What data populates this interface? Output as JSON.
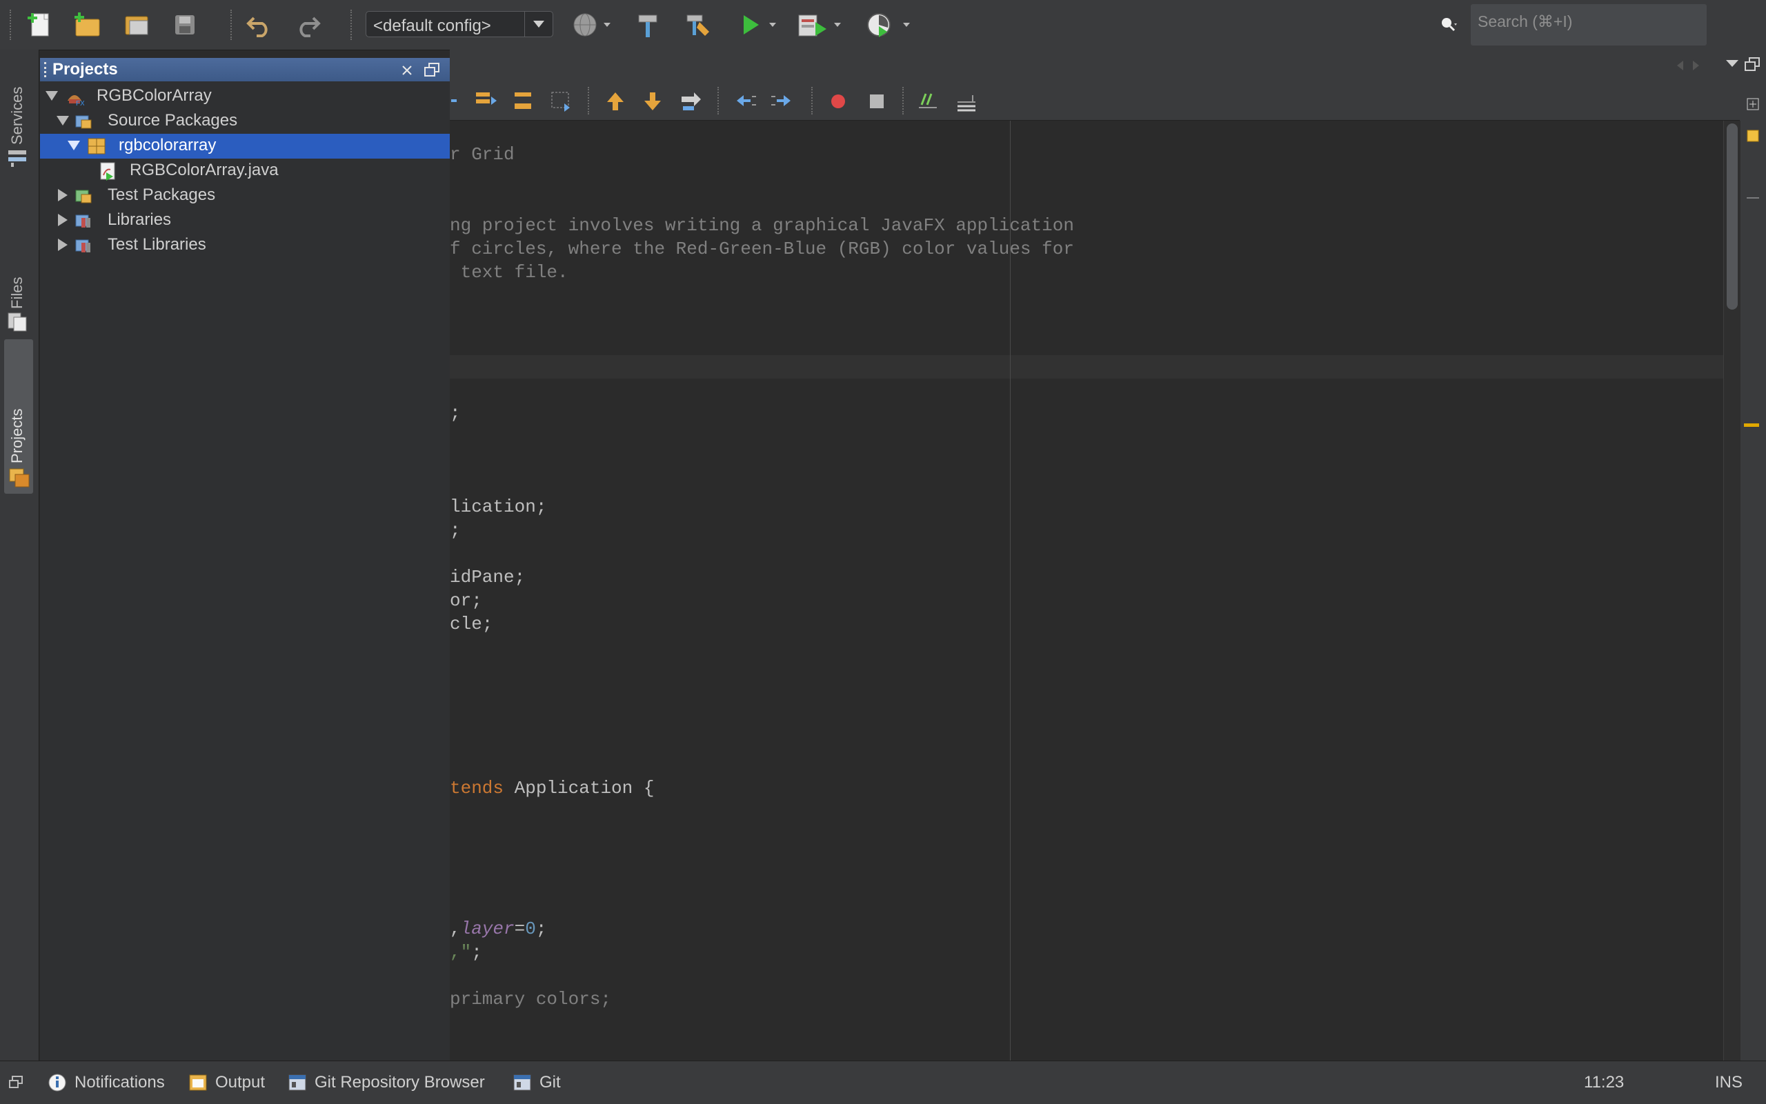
{
  "toolbar": {
    "config_value": "<default config>",
    "search_placeholder": "Search (⌘+I)"
  },
  "rail": {
    "services_label": "Services",
    "files_label": "Files",
    "projects_label": "Projects"
  },
  "projects_panel": {
    "title": "Projects",
    "tree": [
      {
        "label": "RGBColorArray",
        "expanded": true,
        "icon": "javafx-project-icon"
      },
      {
        "label": "Source Packages",
        "expanded": true,
        "icon": "source-packages-icon"
      },
      {
        "label": "rgbcolorarray",
        "expanded": true,
        "selected": true,
        "icon": "package-icon"
      },
      {
        "label": "RGBColorArray.java",
        "icon": "java-file-icon"
      },
      {
        "label": "Test Packages",
        "expanded": false,
        "icon": "test-packages-icon"
      },
      {
        "label": "Libraries",
        "expanded": false,
        "icon": "libraries-icon"
      },
      {
        "label": "Test Libraries",
        "expanded": false,
        "icon": "test-libraries-icon"
      }
    ]
  },
  "editor": {
    "lines": [
      {
        "text": "r Grid"
      },
      {
        "text": "ng project involves writing a graphical JavaFX application"
      },
      {
        "text": "f circles, where the Red-Green-Blue (RGB) color values for"
      },
      {
        "text": " text file."
      },
      {
        "text": ";"
      },
      {
        "text": "lication;"
      },
      {
        "text": ";"
      },
      {
        "text": "idPane;"
      },
      {
        "text": "or;"
      },
      {
        "text": "cle;"
      },
      {
        "kw": "tends",
        "rest": " Application {"
      },
      {
        "pre": ",",
        "var": "layer",
        "eq": "=",
        "num": "0",
        "end": ";"
      },
      {
        "str": ",\"",
        "end": ";"
      },
      {
        "text": "primary colors;"
      }
    ]
  },
  "statusbar": {
    "notifications": "Notifications",
    "output": "Output",
    "git_repo_browser": "Git Repository Browser",
    "git": "Git",
    "position": "11:23",
    "mode": "INS"
  },
  "colors": {
    "selection": "#2b5dbf",
    "panel_header": "#4d6b9c",
    "keyword": "#cc7832",
    "variable": "#9876aa",
    "number": "#6897bb",
    "comment": "#808080"
  }
}
